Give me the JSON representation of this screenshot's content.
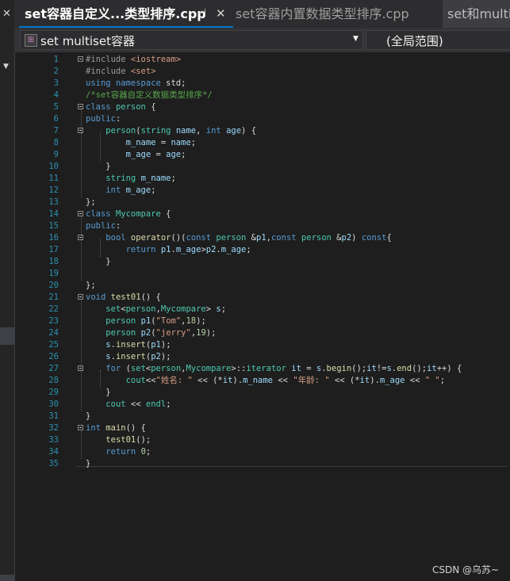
{
  "tabs": [
    {
      "label": "set容器自定义...类型排序.cpp",
      "active": true,
      "pin_icon": "pin-icon",
      "close_icon": "close-icon"
    },
    {
      "label": "set容器内置数据类型排序.cpp",
      "active": false
    },
    {
      "label": "set和multis",
      "active": false
    }
  ],
  "navbar": {
    "project_dropdown": "set multiset容器",
    "scope_dropdown": "(全局范围)"
  },
  "editor": {
    "lines": [
      "#include <iostream>",
      "#include <set>",
      "using namespace std;",
      "/*set容器自定义数据类型排序*/",
      "class person {",
      "public:",
      "    person(string name, int age) {",
      "        m_name = name;",
      "        m_age = age;",
      "    }",
      "    string m_name;",
      "    int m_age;",
      "};",
      "class Mycompare {",
      "public:",
      "    bool operator()(const person &p1,const person &p2) const{",
      "        return p1.m_age>p2.m_age;",
      "    }",
      "",
      "};",
      "void test01() {",
      "    set<person,Mycompare> s;",
      "    person p1(\"Tom\",18);",
      "    person p2(\"jerry\",19);",
      "    s.insert(p1);",
      "    s.insert(p2);",
      "    for (set<person,Mycompare>::iterator it = s.begin();it!=s.end();it++) {",
      "        cout<<\"姓名: \" << (*it).m_name << \"年龄: \" << (*it).m_age << \" \";",
      "    }",
      "    cout << endl;",
      "}",
      "int main() {",
      "    test01();",
      "    return 0;",
      "}"
    ],
    "fold_lines": [
      1,
      5,
      7,
      14,
      16,
      21,
      27,
      32
    ]
  },
  "watermark": "CSDN @乌苏~",
  "colors": {
    "background": "#1e1e1e",
    "line_numbers": "#2b91af",
    "keyword": "#569cd6",
    "comment": "#57a64a",
    "string": "#d69d85",
    "type": "#4ec9b0",
    "accent": "#007acc"
  }
}
